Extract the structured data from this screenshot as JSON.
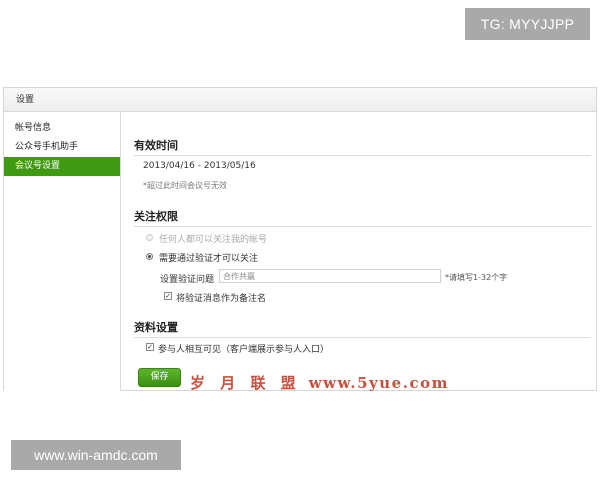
{
  "watermarks": {
    "top_right": "TG: MYYJJPP",
    "bottom_left": "www.win-amdc.com",
    "middle_brand": "岁 月 联 盟",
    "middle_url": "www.5yue.com"
  },
  "panel": {
    "title": "设置"
  },
  "sidebar": {
    "items": [
      {
        "label": "帐号信息",
        "active": false
      },
      {
        "label": "公众号手机助手",
        "active": false
      },
      {
        "label": "会议号设置",
        "active": true
      }
    ]
  },
  "sections": {
    "validity": {
      "title": "有效时间",
      "date_range": "2013/04/16 - 2013/05/16",
      "note": "*超过此时间会议号无效"
    },
    "follow": {
      "title": "关注权限",
      "option_anyone": "任何人都可以关注我的帐号",
      "option_verify": "需要通过验证才可以关注",
      "question_label": "设置验证问题",
      "question_value": "合作共赢",
      "question_hint": "*请填写1-32个字",
      "remark_label": "将验证消息作为备注名",
      "remark_checked": true
    },
    "profile": {
      "title": "资料设置",
      "visible_label": "参与人相互可见（客户端展示参与人入口）",
      "visible_checked": true
    }
  },
  "actions": {
    "save_label": "保存"
  },
  "colors": {
    "accent": "#3f9a12",
    "watermark_red": "#c8503e",
    "watermark_gray": "#a9a9a9"
  }
}
